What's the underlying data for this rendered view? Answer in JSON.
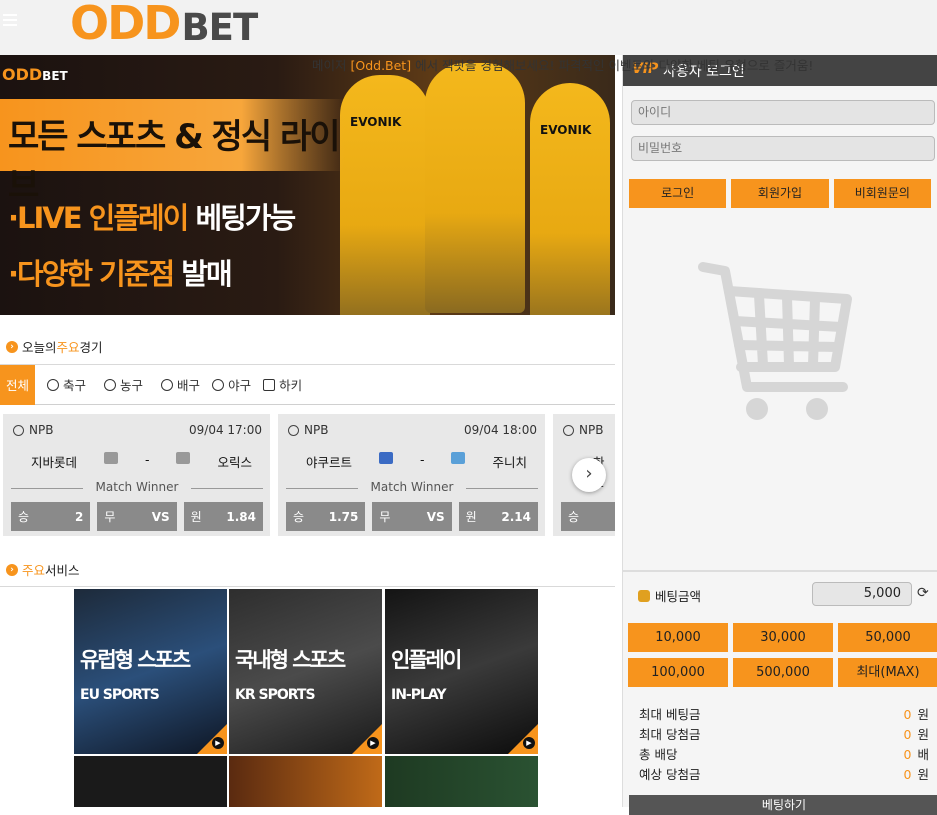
{
  "header": {
    "logo_odd": "ODD",
    "logo_bet": "BET"
  },
  "marquee": {
    "prefix": "메이저 ",
    "brand": "[Odd.Bet]",
    "suffix": " 에서 잭팟을 경험해보세요! 파격적인 이벤트와 다양한 베팅 유형으로 즐거움!"
  },
  "banner": {
    "logo": "ODD",
    "logo_small": "BET",
    "title": "모든 스포츠 & 정식 라이브",
    "line1_a": "·LIVE 인플레이",
    "line1_b": " 베팅가능",
    "line2_a": "·다양한 기준점",
    "line2_b": " 발매",
    "sponsor": "EVONIK"
  },
  "today": {
    "title_pre": "오늘의",
    "title_hl": "주요",
    "title_post": "경기",
    "tabs": [
      "전체",
      "축구",
      "농구",
      "배구",
      "야구",
      "하키"
    ]
  },
  "matches": [
    {
      "league": "NPB",
      "time": "09/04 17:00",
      "home": "지바롯데",
      "away": "오릭스",
      "market": "Match Winner",
      "odds": [
        {
          "label": "승",
          "value": "2"
        },
        {
          "label": "무",
          "value": "VS"
        },
        {
          "label": "원",
          "value": "1.84"
        }
      ]
    },
    {
      "league": "NPB",
      "time": "09/04 18:00",
      "home": "야쿠르트",
      "away": "주니치",
      "market": "Match Winner",
      "odds": [
        {
          "label": "승",
          "value": "1.75"
        },
        {
          "label": "무",
          "value": "VS"
        },
        {
          "label": "원",
          "value": "2.14"
        }
      ]
    },
    {
      "league": "NPB",
      "home": "한신",
      "odds": [
        {
          "label": "승"
        }
      ]
    }
  ],
  "services": {
    "title_hl": "주요",
    "title_post": "서비스",
    "cards": [
      {
        "name": "유럽형 스포츠",
        "en": "EU SPORTS"
      },
      {
        "name": "국내형 스포츠",
        "en": "KR SPORTS"
      },
      {
        "name": "인플레이",
        "en": "IN-PLAY"
      }
    ]
  },
  "panel": {
    "vip": "VIP",
    "title": "사용자 로그인",
    "id_placeholder": "아이디",
    "pw_placeholder": "비밀번호",
    "login": "로그인",
    "join": "회원가입",
    "guest": "비회원문의",
    "bet_label": "베팅금액",
    "bet_value": "5,000",
    "amounts": [
      "10,000",
      "30,000",
      "50,000",
      "100,000",
      "500,000",
      "최대(MAX)"
    ],
    "stats": [
      {
        "label": "최대 베팅금",
        "value": "0",
        "unit": "원"
      },
      {
        "label": "최대 당첨금",
        "value": "0",
        "unit": "원"
      },
      {
        "label": "총 배당",
        "value": "0",
        "unit": "배"
      },
      {
        "label": "예상 당첨금",
        "value": "0",
        "unit": "원"
      }
    ],
    "bet_button": "베팅하기"
  },
  "colors": {
    "accent": "#f7941d",
    "panel_header": "#444444"
  }
}
